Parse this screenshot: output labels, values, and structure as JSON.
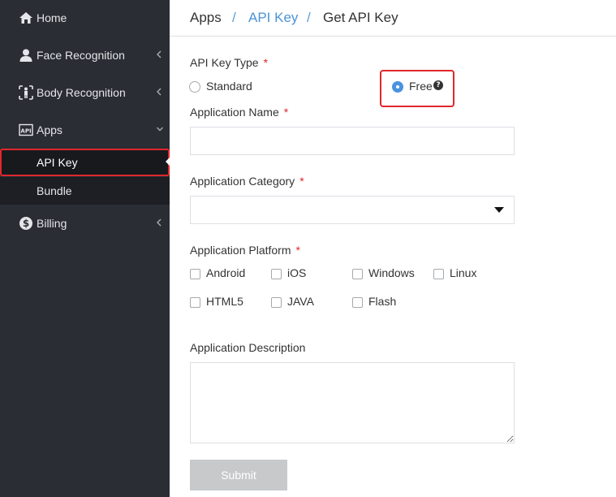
{
  "sidebar": {
    "items": [
      {
        "label": "Home",
        "icon": "home-icon"
      },
      {
        "label": "Face Recognition",
        "icon": "user-icon"
      },
      {
        "label": "Body Recognition",
        "icon": "body-icon"
      },
      {
        "label": "Apps",
        "icon": "api-icon"
      },
      {
        "label": "Billing",
        "icon": "dollar-icon"
      }
    ],
    "sub_items": [
      {
        "label": "API Key",
        "active": true
      },
      {
        "label": "Bundle",
        "active": false
      }
    ]
  },
  "breadcrumb": {
    "items": [
      "Apps",
      "API Key",
      "Get API Key"
    ],
    "separator": "/"
  },
  "form": {
    "key_type": {
      "label": "API Key Type",
      "required_mark": "*",
      "options": [
        "Standard",
        "Free"
      ],
      "selected": "Free"
    },
    "app_name": {
      "label": "Application Name",
      "required_mark": "*",
      "value": "",
      "placeholder": ""
    },
    "app_category": {
      "label": "Application Category",
      "required_mark": "*",
      "value": ""
    },
    "app_platform": {
      "label": "Application Platform",
      "required_mark": "*",
      "options": [
        "Android",
        "iOS",
        "Windows",
        "Linux",
        "HTML5",
        "JAVA",
        "Flash"
      ]
    },
    "app_description": {
      "label": "Application Description",
      "value": ""
    },
    "submit_label": "Submit"
  },
  "colors": {
    "sidebar_bg": "#2a2d33",
    "accent": "#4b93d8",
    "highlight_red": "#e0272b",
    "submit_disabled": "#c8c9cb"
  }
}
